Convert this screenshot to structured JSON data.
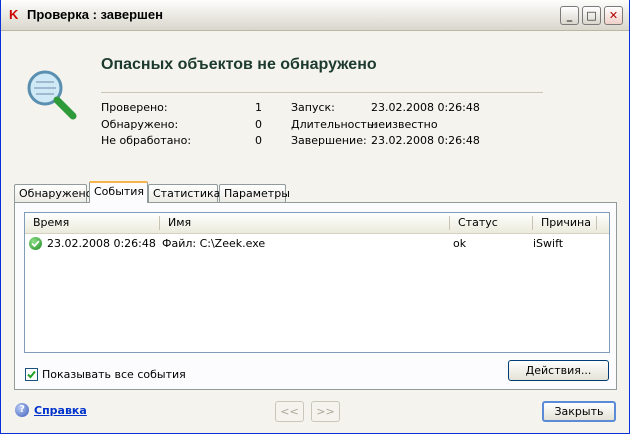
{
  "window": {
    "title": "Проверка : завершен",
    "minimize": "_",
    "maximize": "□",
    "close": "✕"
  },
  "header": {
    "headline": "Опасных объектов не обнаружено"
  },
  "stats": {
    "checked_label": "Проверено:",
    "checked_value": "1",
    "found_label": "Обнаружено:",
    "found_value": "0",
    "unprocessed_label": "Не обработано:",
    "unprocessed_value": "0",
    "start_label": "Запуск:",
    "start_value": "23.02.2008 0:26:48",
    "duration_label": "Длительность:",
    "duration_value": "неизвестно",
    "end_label": "Завершение:",
    "end_value": "23.02.2008 0:26:48"
  },
  "tabs": [
    {
      "label": "Обнаружено"
    },
    {
      "label": "События"
    },
    {
      "label": "Статистика"
    },
    {
      "label": "Параметры"
    }
  ],
  "events": {
    "columns": [
      "Время",
      "Имя",
      "Статус",
      "Причина"
    ],
    "rows": [
      {
        "time": "23.02.2008 0:26:48",
        "name": "Файл: C:\\Zeek.exe",
        "status": "ok",
        "reason": "iSwift"
      }
    ]
  },
  "show_all_label": "Показывать все события",
  "actions_label": "Действия...",
  "footer": {
    "help_label": "Справка",
    "prev_label": "<<",
    "next_label": ">>",
    "close_label": "Закрыть"
  }
}
